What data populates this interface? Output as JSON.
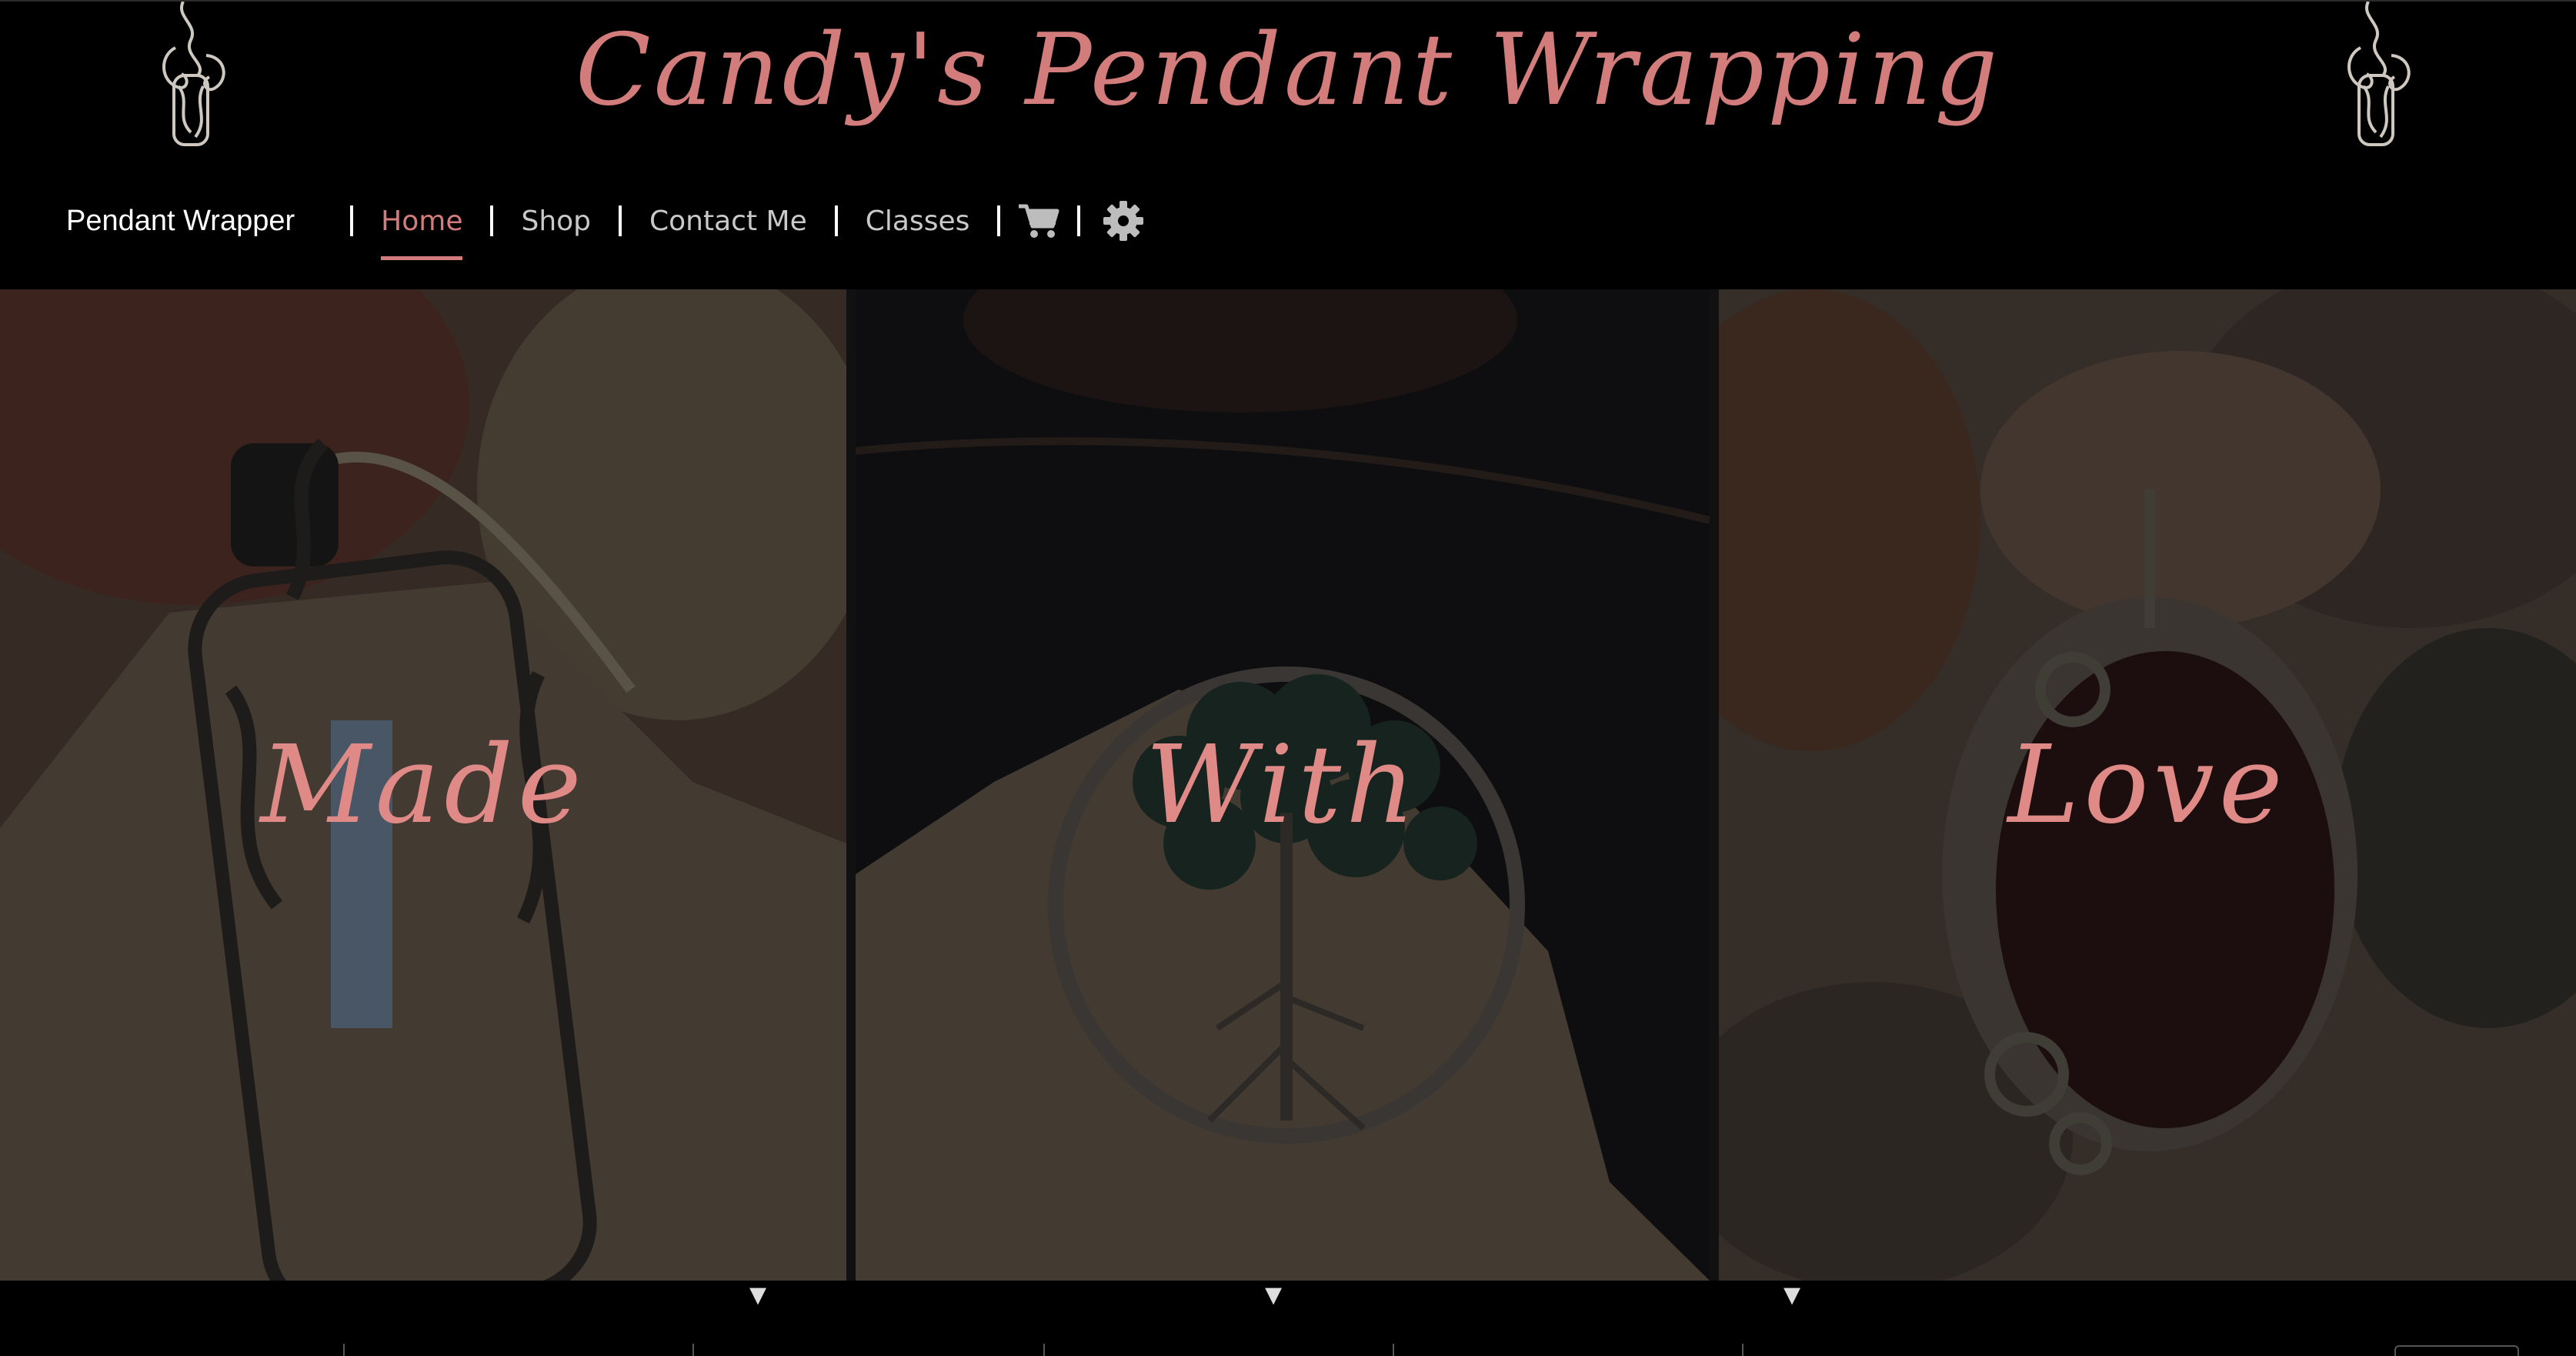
{
  "header": {
    "site_title": "Candy's Pendant Wrapping",
    "logo_icon": "wire-wrapped-pendant-icon"
  },
  "nav": {
    "brand": "Pendant Wrapper",
    "links": [
      {
        "label": "Home",
        "active": true
      },
      {
        "label": "Shop",
        "active": false
      },
      {
        "label": "Contact Me",
        "active": false
      },
      {
        "label": "Classes",
        "active": false
      }
    ],
    "cart_icon": "cart-icon",
    "settings_icon": "gear-icon"
  },
  "hero": {
    "panels": [
      {
        "word": "Made"
      },
      {
        "word": "With"
      },
      {
        "word": "Love"
      }
    ]
  },
  "colors": {
    "accent": "#d27c7b",
    "background": "#000000",
    "nav_text": "#c9c9c9"
  }
}
